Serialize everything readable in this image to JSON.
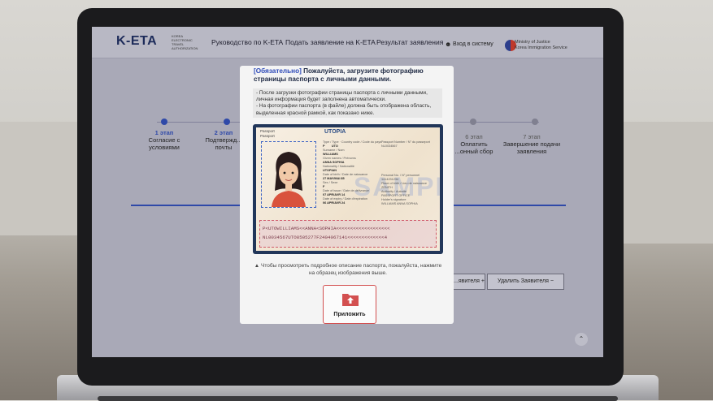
{
  "site": {
    "logo": "K-ETA",
    "logo_sub": "KOREA ELECTRONIC TRAVEL AUTHORIZATION",
    "nav": [
      "Руководство по K-ETA",
      "Подать заявление на K-ETA",
      "Результат заявления"
    ],
    "login": "Вход в систему",
    "ministry": "Ministry of Justice",
    "service": "Korea Immigration Service"
  },
  "steps": [
    {
      "num": "1 этап",
      "label": "Согласие с условиями",
      "state": "done"
    },
    {
      "num": "2 этап",
      "label": "Подтвержд... почты",
      "state": "done"
    },
    {
      "num": "6 этап",
      "label": "Оплатить ...онный сбор",
      "state": "todo"
    },
    {
      "num": "7 этап",
      "label": "Завершение подачи заявления",
      "state": "todo"
    }
  ],
  "buttons": {
    "add_applicant": "...явителя +",
    "delete_applicant": "Удалить Заявителя −"
  },
  "modal": {
    "required_tag": "[Обязательно]",
    "title": "Пожалуйста, загрузите фотографию страницы паспорта с личными данными.",
    "notes": [
      "- После загрузки фотографии страницы паспорта с личными данными, личная информация будет заполнена автоматически.",
      "- На фотографии паспорта (в файле) должна быть отображена область, выделенная красной рамкой, как показано ниже."
    ],
    "passport_sample": {
      "label_ru": "Passport",
      "label_en": "Passport",
      "country": "UTOPIA",
      "type": "P",
      "code": "UTO",
      "passport_no": "NL0034567",
      "surname": "WILLIAMS",
      "given_names": "ANNA SOPHIA",
      "nationality": "UTOPIAN",
      "birth_date": "27 MAY/MAI 85",
      "personal_no": "1414231234",
      "sex": "F",
      "birth_place": "ZENITH",
      "issue_date": "07 APR/AVR 14",
      "authority": "PASSPORT OFFICE",
      "expiry_date": "06 APR/AVR 24",
      "holder_signature": "WILLIAMS ANNA SOPHIA",
      "watermark": "SAMPLE",
      "mrz_line1": "P<UTOWILLIAMS<<ANNA<SOPHIA<<<<<<<<<<<<<<<<<<<",
      "mrz_line2": "NL0034567UTO8505277F2404067141<<<<<<<<<<<<<4"
    },
    "hint": "▲ Чтобы просмотреть подробное описание паспорта, пожалуйста, нажмите на образец изображения выше.",
    "upload_label": "Приложить"
  },
  "colors": {
    "brand_blue": "#2b48b8",
    "upload_border": "#d35050"
  }
}
